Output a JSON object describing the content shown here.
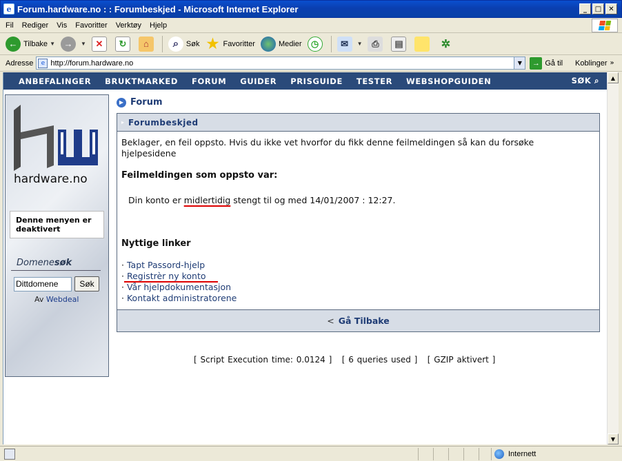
{
  "window": {
    "title": "Forum.hardware.no : : Forumbeskjed - Microsoft Internet Explorer",
    "controls": [
      "_",
      "□",
      "✕"
    ]
  },
  "menu": [
    "Fil",
    "Rediger",
    "Vis",
    "Favoritter",
    "Verktøy",
    "Hjelp"
  ],
  "toolbar": {
    "back": "Tilbake",
    "search": "Søk",
    "favorites": "Favoritter",
    "media": "Medier"
  },
  "address": {
    "label": "Adresse",
    "url": "http://forum.hardware.no",
    "go": "Gå til",
    "links": "Koblinger"
  },
  "sitenav": {
    "items": [
      "ANBEFALINGER",
      "BRUKTMARKED",
      "FORUM",
      "GUIDER",
      "PRISGUIDE",
      "TESTER",
      "WEBSHOPGUIDEN"
    ],
    "search": "SØK"
  },
  "sidebar": {
    "logo_text": "hardware.no",
    "menu_disabled": "Denne menyen er deaktivert",
    "domene_prefix": "Domene",
    "domene_suffix": "søk",
    "domene_value": "Dittdomene",
    "domene_button": "Søk",
    "by_prefix": "Av",
    "by_link": "Webdeal"
  },
  "main": {
    "breadcrumb": "Forum",
    "panel_title": "Forumbeskjed",
    "message": "Beklager, en feil oppsto. Hvis du ikke vet hvorfor du fikk denne feilmeldingen så kan du forsøke hjelpesidene",
    "error_title": "Feilmeldingen som oppsto var:",
    "error_pre": "Din konto er ",
    "error_highlight": "midlertidig",
    "error_post": " stengt til og med 14/01/2007 : 12:27.",
    "useful_title": "Nyttige linker",
    "links": [
      "Tapt Passord-hjelp",
      "Registrèr ny konto",
      "Vår hjelpdokumentasjon",
      "Kontakt administratorene"
    ],
    "back_label": "Gå Tilbake"
  },
  "footer": {
    "stats": "[ Script Execution time: 0.0124 ]   [ 6 queries used ]   [ GZIP aktivert ]"
  },
  "status": {
    "zone": "Internett"
  }
}
